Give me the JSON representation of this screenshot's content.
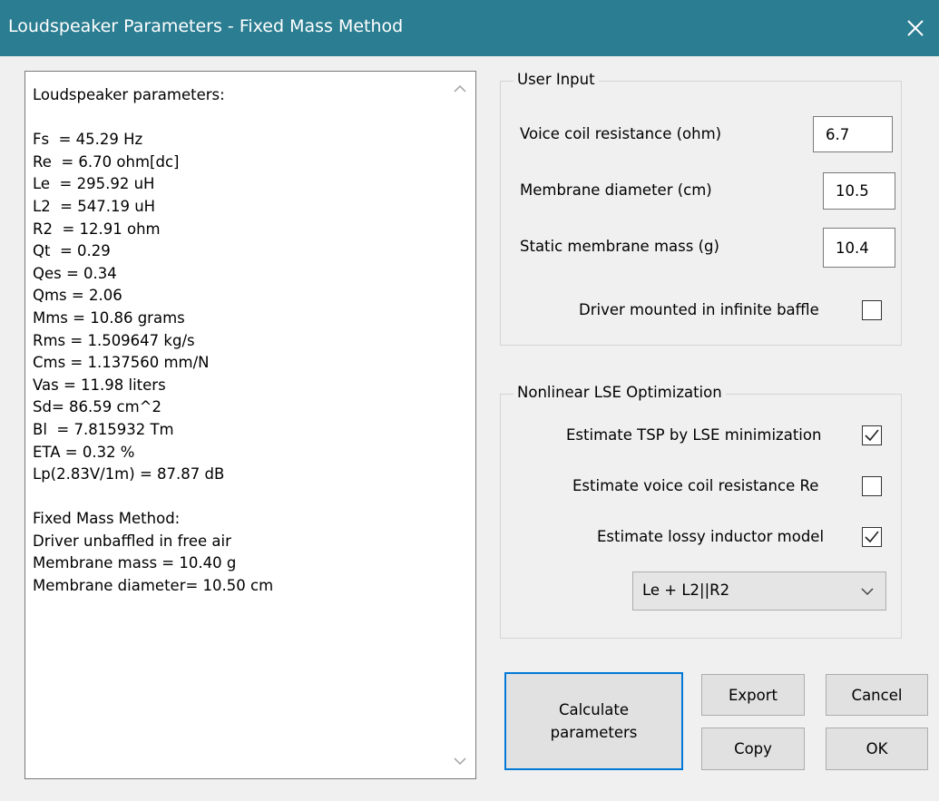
{
  "window": {
    "title": "Loudspeaker Parameters - Fixed Mass Method",
    "close_glyph": "✕"
  },
  "output": {
    "lines": [
      "Loudspeaker parameters:",
      "",
      "Fs  = 45.29 Hz",
      "Re  = 6.70 ohm[dc]",
      "Le  = 295.92 uH",
      "L2  = 547.19 uH",
      "R2  = 12.91 ohm",
      "Qt  = 0.29",
      "Qes = 0.34",
      "Qms = 2.06",
      "Mms = 10.86 grams",
      "Rms = 1.509647 kg/s",
      "Cms = 1.137560 mm/N",
      "Vas = 11.98 liters",
      "Sd= 86.59 cm^2",
      "Bl  = 7.815932 Tm",
      "ETA = 0.32 %",
      "Lp(2.83V/1m) = 87.87 dB",
      "",
      "Fixed Mass Method:",
      "Driver unbaffled in free air",
      "Membrane mass = 10.40 g",
      "Membrane diameter= 10.50 cm"
    ]
  },
  "user_input": {
    "title": "User Input",
    "voice_coil_label": "Voice coil resistance (ohm)",
    "voice_coil_value": "6.7",
    "diameter_label": "Membrane diameter (cm)",
    "diameter_value": "10.5",
    "mass_label": "Static membrane mass (g)",
    "mass_value": "10.4",
    "infinite_baffle_label": "Driver mounted in infinite baffle",
    "infinite_baffle_checked": false
  },
  "optimization": {
    "title": "Nonlinear LSE Optimization",
    "tsp_label": "Estimate TSP by LSE minimization",
    "tsp_checked": true,
    "re_label": "Estimate voice coil resistance Re",
    "re_checked": false,
    "lossy_label": "Estimate lossy inductor model",
    "lossy_checked": true,
    "model_selected": "Le + L2||R2"
  },
  "buttons": {
    "calculate_line1": "Calculate",
    "calculate_line2": "parameters",
    "export": "Export",
    "cancel": "Cancel",
    "copy": "Copy",
    "ok": "OK"
  },
  "colors": {
    "titlebar": "#2b7d91",
    "primary_button_border": "#0078d7"
  }
}
